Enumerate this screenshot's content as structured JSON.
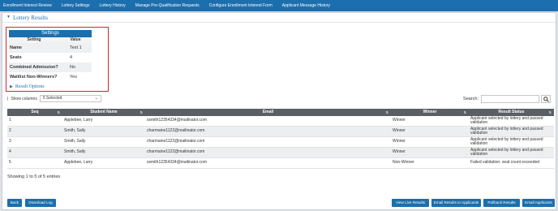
{
  "nav": [
    "Enrollment Interest Review",
    "Lottery Settings",
    "Lottery History",
    "Manage Pre-Qualification Requests",
    "Configure Enrollment Interest Form",
    "Applicant Message History"
  ],
  "card_title": "Lottery Results",
  "settings": {
    "title": "Settings",
    "col_setting": "Setting",
    "col_value": "Value",
    "rows": [
      {
        "label": "Name",
        "value": "Test 1"
      },
      {
        "label": "Seats",
        "value": "4"
      },
      {
        "label": "Combined Admission?",
        "value": "No"
      },
      {
        "label": "Waitlist Non-Winners?",
        "value": "Yes"
      }
    ]
  },
  "result_options": "Result Options",
  "show_columns": {
    "label": "Show columns",
    "selected": "5 Selected"
  },
  "search_label": "Search:",
  "table": {
    "headers": [
      "Seq",
      "Student Name",
      "Email",
      "Winner",
      "Result Status"
    ],
    "rows": [
      {
        "seq": "1",
        "name": "Applebee, Larry",
        "email": "ssmith12354334@mailinator.com",
        "winner": "Winner",
        "status": "Applicant selected by lottery and passed validation"
      },
      {
        "seq": "2",
        "name": "Smith, Sally",
        "email": "charmaine1122@mailinator.com",
        "winner": "Winner",
        "status": "Applicant selected by lottery and passed validation"
      },
      {
        "seq": "3",
        "name": "Smith, Sally",
        "email": "charmaine1122@mailinator.com",
        "winner": "Winner",
        "status": "Applicant selected by lottery and passed validation"
      },
      {
        "seq": "4",
        "name": "Smith, Sally",
        "email": "charmaine1122@mailinator.com",
        "winner": "Winner",
        "status": "Applicant selected by lottery and passed validation"
      },
      {
        "seq": "5",
        "name": "Applebee, Larry",
        "email": "ssmith12354334@mailinator.com",
        "winner": "Non-Winner",
        "status": "Failed validation: seat count exceeded"
      }
    ]
  },
  "entries_text": "Showing 1 to 5 of 5 entries",
  "buttons": {
    "back": "Back",
    "download_log": "Download Log",
    "view_live": "View Live Results",
    "email_results": "Email Results to Applicants",
    "rollback": "Rollback Results",
    "email_applicants": "Email Applicants"
  },
  "colors": {
    "primary": "#1b6fae",
    "highlight_border": "#d9232e",
    "table_header": "#5a5f66"
  }
}
